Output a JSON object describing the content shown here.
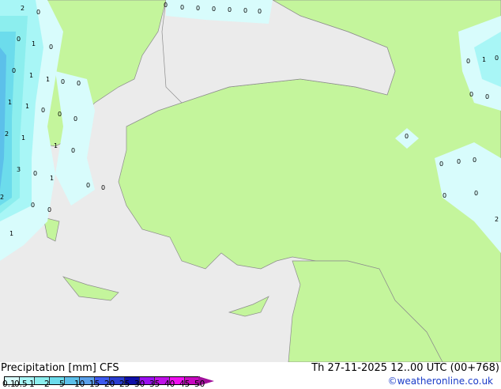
{
  "title": "Precipitation [mm] CFS",
  "datetime": "Th 27-11-2025 12..00 UTC (00+768)",
  "credit": "©weatheronline.co.uk",
  "legend": {
    "ticks": [
      "0.1",
      "0.5",
      "1",
      "2",
      "5",
      "10",
      "15",
      "20",
      "25",
      "30",
      "35",
      "40",
      "45",
      "50"
    ],
    "colors": [
      "#d8fcfc",
      "#a8f6f6",
      "#8ceeee",
      "#6cdcec",
      "#5cc0ea",
      "#5aa0ea",
      "#3c5af0",
      "#2a3ed0",
      "#1010a8",
      "#9a10f0",
      "#c010e8",
      "#f010f0",
      "#c808c0"
    ]
  },
  "map_labels": [
    "2",
    "0",
    "0",
    "0",
    "0",
    "0",
    "0",
    "0",
    "0",
    "0",
    "1",
    "0",
    "0",
    "1",
    "1",
    "0",
    "0",
    "0",
    "1",
    "1",
    "0",
    "0",
    "2",
    "1",
    "0",
    "1",
    "3",
    "0",
    "1",
    "0",
    "2",
    "0",
    "0",
    "1",
    "0",
    "0",
    "0",
    "1",
    "0",
    "0",
    "0",
    "0",
    "0",
    "0",
    "0",
    "2",
    "0"
  ],
  "colors": {
    "sea": "#ebebeb",
    "land": "#c4f59c",
    "border": "#8c8c8c"
  }
}
